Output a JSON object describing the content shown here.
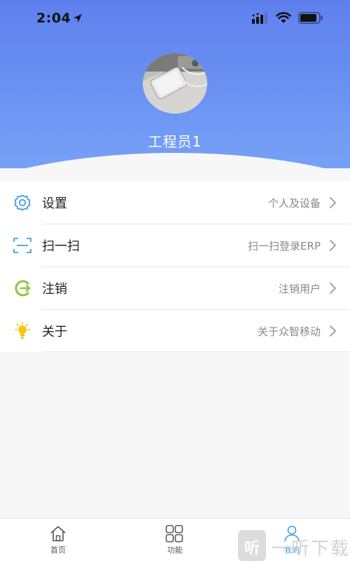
{
  "status_bar": {
    "time": "2:04",
    "location_icon": "location-arrow-icon",
    "cellular_icon": "cellular-signal-icon",
    "wifi_icon": "wifi-icon",
    "battery_icon": "battery-icon"
  },
  "profile": {
    "avatar_icon": "avatar-photo",
    "name": "工程员1"
  },
  "menu": [
    {
      "icon": "gear-icon",
      "label": "设置",
      "sub": "个人及设备"
    },
    {
      "icon": "scan-icon",
      "label": "扫一扫",
      "sub": "扫一扫登录ERP"
    },
    {
      "icon": "logout-icon",
      "label": "注销",
      "sub": "注销用户"
    },
    {
      "icon": "lightbulb-icon",
      "label": "关于",
      "sub": "关于众智移动"
    }
  ],
  "tabbar": [
    {
      "icon": "home-icon",
      "label": "首页",
      "active": false
    },
    {
      "icon": "grid-icon",
      "label": "功能",
      "active": false
    },
    {
      "icon": "user-icon",
      "label": "我的",
      "active": true
    }
  ],
  "watermark": {
    "box_char": "听",
    "text": "一听下载"
  },
  "colors": {
    "header_top": "#5e80ee",
    "header_bottom": "#77a1f6",
    "accent": "#3ea0e6",
    "icon_gear": "#3ea0e6",
    "icon_logout": "#8cc63f",
    "icon_bulb": "#f5c518"
  }
}
